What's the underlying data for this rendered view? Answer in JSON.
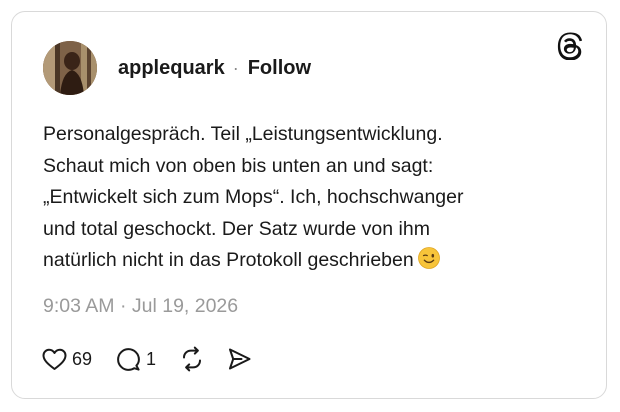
{
  "post": {
    "username": "applequark",
    "separator": "·",
    "follow_label": "Follow",
    "text_lines": [
      "Personalgespräch. Teil „Leistungsentwicklung.",
      "Schaut mich von oben bis unten an und sagt:",
      "„Entwickelt sich zum Mops“. Ich, hochschwanger",
      "und total geschockt. Der Satz wurde von ihm",
      "natürlich nicht in das Protokoll geschrieben"
    ],
    "emoji": "😉",
    "timestamp": "9:03 AM · Jul 19, 2026"
  },
  "actions": {
    "likes": "69",
    "replies": "1"
  },
  "icons": {
    "brand": "threads-logo-icon",
    "like": "heart-icon",
    "reply": "comment-icon",
    "repost": "repost-icon",
    "share": "send-icon"
  },
  "colors": {
    "text": "#1a1a1a",
    "muted": "#9a9a9a",
    "border": "#d9d9d9"
  }
}
